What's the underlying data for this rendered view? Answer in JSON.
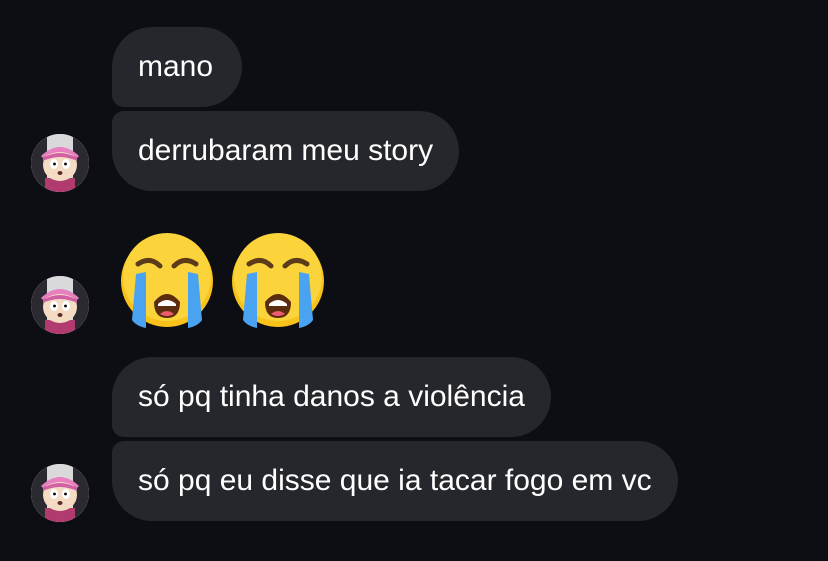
{
  "messages": [
    {
      "text": "mano"
    },
    {
      "text": "derrubaram meu story"
    },
    {
      "emojis": [
        "loudly-crying-face-icon",
        "loudly-crying-face-icon"
      ]
    },
    {
      "text": "só pq tinha danos a violência"
    },
    {
      "text": "só pq eu disse que ia tacar fogo em vc"
    }
  ],
  "colors": {
    "background": "#0c0e14",
    "bubble": "#25272c",
    "text": "#ffffff"
  }
}
